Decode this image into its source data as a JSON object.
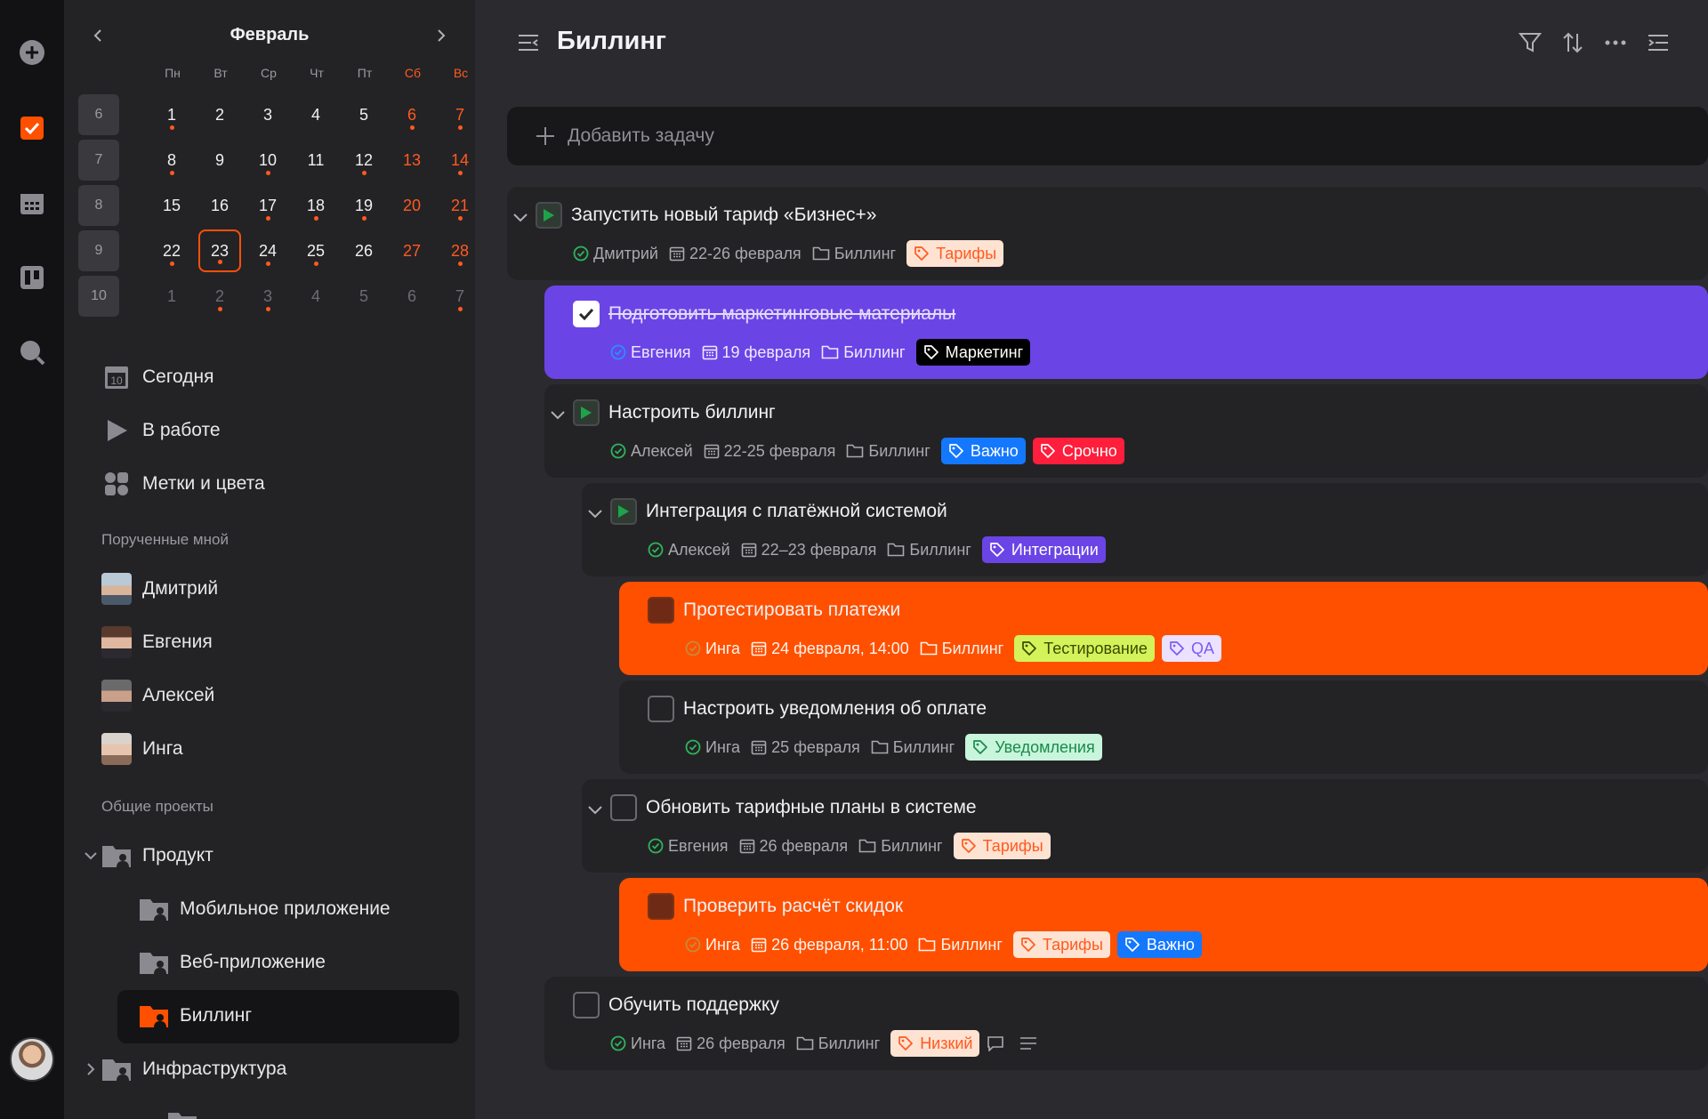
{
  "calendar": {
    "month": "Февраль",
    "weekdays": [
      "Пн",
      "Вт",
      "Ср",
      "Чт",
      "Пт",
      "Сб",
      "Вс"
    ],
    "weeks": [
      {
        "num": "6",
        "days": [
          "1",
          "2",
          "3",
          "4",
          "5",
          "6",
          "7"
        ]
      },
      {
        "num": "7",
        "days": [
          "8",
          "9",
          "10",
          "11",
          "12",
          "13",
          "14"
        ]
      },
      {
        "num": "8",
        "days": [
          "15",
          "16",
          "17",
          "18",
          "19",
          "20",
          "21"
        ]
      },
      {
        "num": "9",
        "days": [
          "22",
          "23",
          "24",
          "25",
          "26",
          "27",
          "28"
        ]
      },
      {
        "num": "10",
        "days": [
          "1",
          "2",
          "3",
          "4",
          "5",
          "6",
          "7"
        ]
      }
    ],
    "today": "23",
    "dots": [
      [
        1,
        0
      ],
      [
        1,
        6
      ],
      [
        2,
        2
      ],
      [
        2,
        3
      ],
      [
        2,
        4
      ],
      [
        3,
        1
      ],
      [
        3,
        2
      ],
      [
        3,
        3
      ],
      [
        4,
        1
      ],
      [
        4,
        2
      ],
      [
        4,
        6
      ],
      [
        0,
        0
      ],
      [
        0,
        5
      ],
      [
        0,
        6
      ],
      [
        1,
        2
      ],
      [
        1,
        4
      ],
      [
        2,
        6
      ],
      [
        3,
        0
      ],
      [
        3,
        6
      ]
    ]
  },
  "nav": {
    "today": "Сегодня",
    "today_icon_num": "10",
    "in_work": "В работе",
    "labels": "Метки и цвета"
  },
  "assigned": {
    "title": "Порученные мной",
    "people": [
      "Дмитрий",
      "Евгения",
      "Алексей",
      "Инга"
    ]
  },
  "projects": {
    "title": "Общие проекты",
    "items": [
      "Продукт",
      "Мобильное приложение",
      "Веб-приложение",
      "Биллинг",
      "Инфраструктура"
    ]
  },
  "header": {
    "title": "Биллинг"
  },
  "add_task": {
    "placeholder": "Добавить задачу"
  },
  "tasks": [
    {
      "title": "Запустить новый тариф «Бизнес+»",
      "person": "Дмитрий",
      "date": "22-26 февраля",
      "project": "Биллинг",
      "tags": [
        "Тарифы"
      ]
    },
    {
      "title": "Подготовить маркетинговые материалы",
      "person": "Евгения",
      "date": "19 февраля",
      "project": "Биллинг",
      "tags": [
        "Маркетинг"
      ]
    },
    {
      "title": "Настроить биллинг",
      "person": "Алексей",
      "date": "22-25 февраля",
      "project": "Биллинг",
      "tags": [
        "Важно",
        "Срочно"
      ]
    },
    {
      "title": "Интеграция с платёжной системой",
      "person": "Алексей",
      "date": "22–23 февраля",
      "project": "Биллинг",
      "tags": [
        "Интеграции"
      ]
    },
    {
      "title": "Протестировать платежи",
      "person": "Инга",
      "date": "24 февраля, 14:00",
      "project": "Биллинг",
      "tags": [
        "Тестирование",
        "QA"
      ]
    },
    {
      "title": "Настроить уведомления об оплате",
      "person": "Инга",
      "date": "25 февраля",
      "project": "Биллинг",
      "tags": [
        "Уведомления"
      ]
    },
    {
      "title": "Обновить тарифные планы в системе",
      "person": "Евгения",
      "date": "26 февраля",
      "project": "Биллинг",
      "tags": [
        "Тарифы"
      ]
    },
    {
      "title": "Проверить расчёт скидок",
      "person": "Инга",
      "date": "26 февраля, 11:00",
      "project": "Биллинг",
      "tags": [
        "Тарифы",
        "Важно"
      ]
    },
    {
      "title": "Обучить поддержку",
      "person": "Инга",
      "date": "26 февраля",
      "project": "Биллинг",
      "tags": [
        "Низкий"
      ]
    }
  ],
  "colors": {
    "accent": "#ff5000",
    "purple": "#6b44e6",
    "tag_tariff_bg": "#ffe3d2",
    "tag_tariff_fg": "#ff5a1f",
    "tag_marketing_bg": "#000000",
    "tag_marketing_fg": "#ffffff",
    "tag_important_bg": "#1478ff",
    "tag_important_fg": "#ffffff",
    "tag_urgent_bg": "#ff1e3c",
    "tag_urgent_fg": "#ffffff",
    "tag_integr_bg": "#6b44e6",
    "tag_integr_fg": "#ffffff",
    "tag_test_bg": "#d4f25a",
    "tag_test_fg": "#3a4a00",
    "tag_qa_bg": "#ece2ff",
    "tag_qa_fg": "#7b5cf0",
    "tag_notif_bg": "#c8f5dc",
    "tag_notif_fg": "#1b8a4a"
  }
}
